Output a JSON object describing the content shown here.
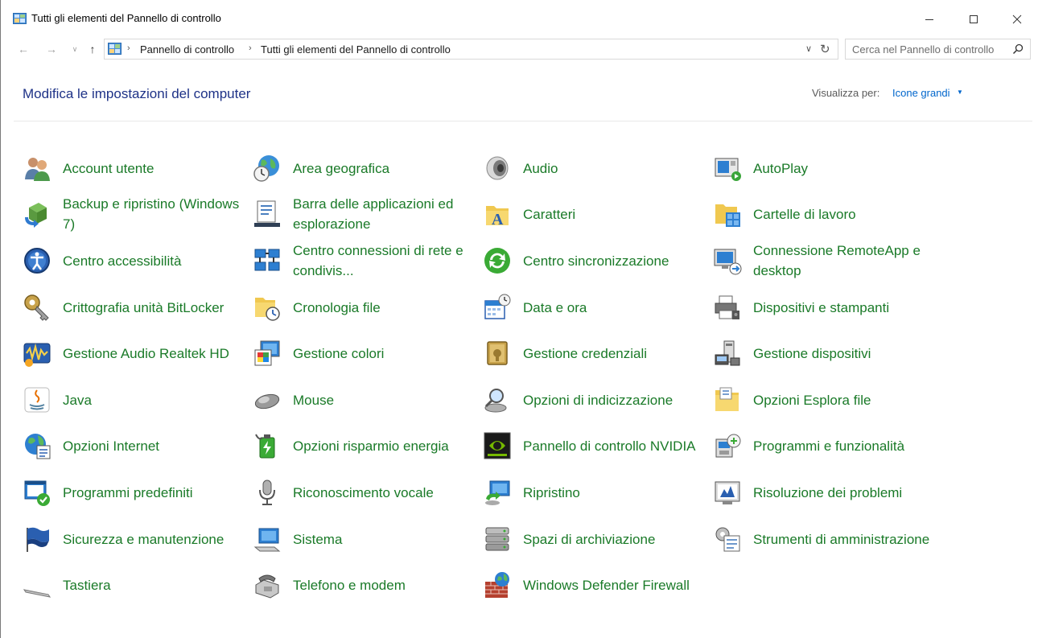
{
  "window": {
    "title": "Tutti gli elementi del Pannello di controllo"
  },
  "address": {
    "crumbs": [
      "Pannello di controllo",
      "Tutti gli elementi del Pannello di controllo"
    ],
    "search_placeholder": "Cerca nel Pannello di controllo"
  },
  "header": {
    "title": "Modifica le impostazioni del computer",
    "view_label": "Visualizza per:",
    "view_value": "Icone grandi"
  },
  "colors": {
    "link_green": "#1a7a28",
    "title_blue": "#1e3287",
    "accent_blue": "#0066cc"
  },
  "items": [
    {
      "label": "Account utente",
      "icon": "users-icon"
    },
    {
      "label": "Area geografica",
      "icon": "globe-clock-icon"
    },
    {
      "label": "Audio",
      "icon": "speaker-icon"
    },
    {
      "label": "AutoPlay",
      "icon": "autoplay-icon"
    },
    {
      "label": "Backup e ripristino (Windows 7)",
      "icon": "backup-icon"
    },
    {
      "label": "Barra delle applicazioni ed esplorazione",
      "icon": "taskbar-icon"
    },
    {
      "label": "Caratteri",
      "icon": "fonts-folder-icon"
    },
    {
      "label": "Cartelle di lavoro",
      "icon": "work-folders-icon"
    },
    {
      "label": "Centro accessibilità",
      "icon": "accessibility-icon"
    },
    {
      "label": "Centro connessioni di rete e condivis...",
      "icon": "network-icon"
    },
    {
      "label": "Centro sincronizzazione",
      "icon": "sync-icon"
    },
    {
      "label": "Connessione RemoteApp e desktop",
      "icon": "remoteapp-icon"
    },
    {
      "label": "Crittografia unità BitLocker",
      "icon": "bitlocker-key-icon"
    },
    {
      "label": "Cronologia file",
      "icon": "file-history-icon"
    },
    {
      "label": "Data e ora",
      "icon": "calendar-clock-icon"
    },
    {
      "label": "Dispositivi e stampanti",
      "icon": "printer-icon"
    },
    {
      "label": "Gestione Audio Realtek HD",
      "icon": "realtek-audio-icon"
    },
    {
      "label": "Gestione colori",
      "icon": "color-management-icon"
    },
    {
      "label": "Gestione credenziali",
      "icon": "credential-vault-icon"
    },
    {
      "label": "Gestione dispositivi",
      "icon": "device-manager-icon"
    },
    {
      "label": "Java",
      "icon": "java-icon"
    },
    {
      "label": "Mouse",
      "icon": "mouse-icon"
    },
    {
      "label": "Opzioni di indicizzazione",
      "icon": "indexing-icon"
    },
    {
      "label": "Opzioni Esplora file",
      "icon": "folder-options-icon"
    },
    {
      "label": "Opzioni Internet",
      "icon": "internet-options-icon"
    },
    {
      "label": "Opzioni risparmio energia",
      "icon": "power-options-icon"
    },
    {
      "label": "Pannello di controllo NVIDIA",
      "icon": "nvidia-icon"
    },
    {
      "label": "Programmi e funzionalità",
      "icon": "programs-icon"
    },
    {
      "label": "Programmi predefiniti",
      "icon": "default-programs-icon"
    },
    {
      "label": "Riconoscimento vocale",
      "icon": "microphone-icon"
    },
    {
      "label": "Ripristino",
      "icon": "recovery-icon"
    },
    {
      "label": "Risoluzione dei problemi",
      "icon": "troubleshoot-icon"
    },
    {
      "label": "Sicurezza e manutenzione",
      "icon": "security-flag-icon"
    },
    {
      "label": "Sistema",
      "icon": "system-icon"
    },
    {
      "label": "Spazi di archiviazione",
      "icon": "storage-spaces-icon"
    },
    {
      "label": "Strumenti di amministrazione",
      "icon": "admin-tools-icon"
    },
    {
      "label": "Tastiera",
      "icon": "keyboard-icon"
    },
    {
      "label": "Telefono e modem",
      "icon": "phone-modem-icon"
    },
    {
      "label": "Windows Defender Firewall",
      "icon": "firewall-icon"
    }
  ]
}
